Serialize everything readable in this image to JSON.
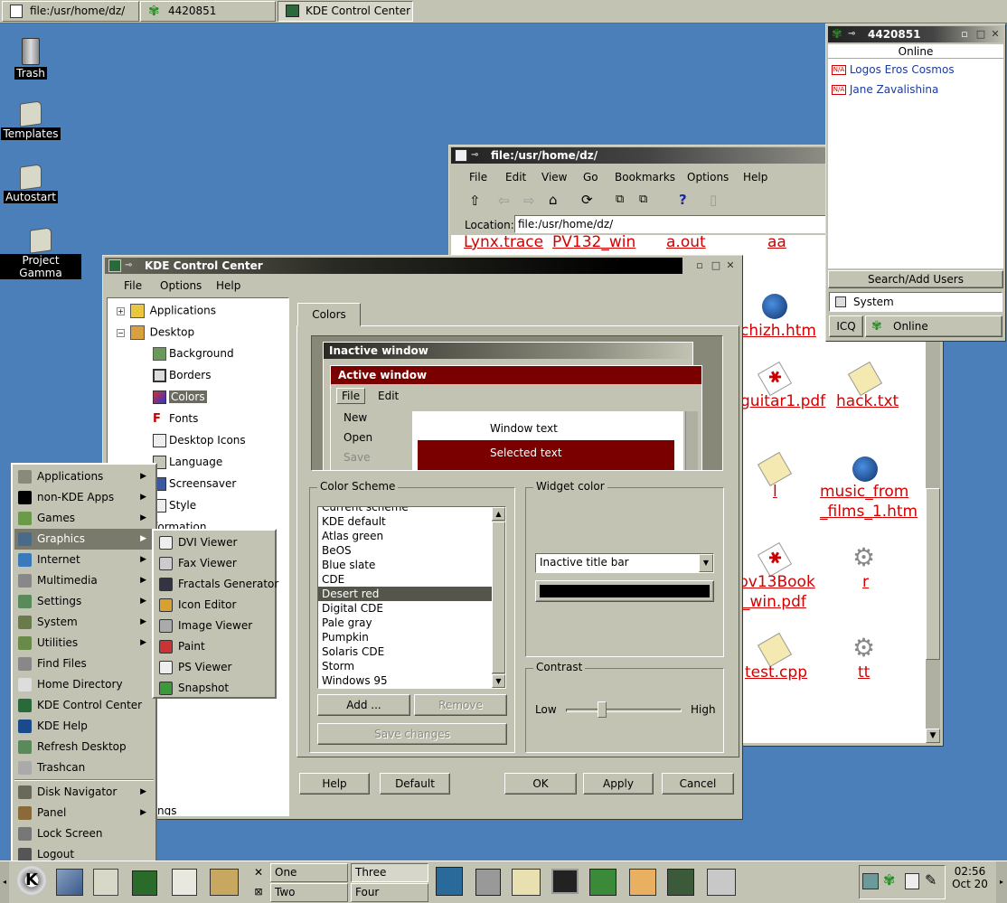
{
  "top_tasks": [
    {
      "label": "file:/usr/home/dz/"
    },
    {
      "label": "4420851"
    },
    {
      "label": "KDE Control Center"
    }
  ],
  "desktop_icons": [
    {
      "label": "Trash"
    },
    {
      "label": "Templates"
    },
    {
      "label": "Autostart"
    },
    {
      "label": "Project Gamma"
    }
  ],
  "icq": {
    "title": "4420851",
    "group": "Online",
    "contacts": [
      "Logos Eros Cosmos",
      "Jane Zavalishina"
    ],
    "search_button": "Search/Add Users",
    "system_label": "System",
    "icq_button": "ICQ",
    "status_button": "Online"
  },
  "konqueror": {
    "title": "file:/usr/home/dz/",
    "menu": [
      "File",
      "Edit",
      "View",
      "Go",
      "Bookmarks",
      "Options",
      "Help"
    ],
    "location_label": "Location:",
    "location_value": "file:/usr/home/dz/",
    "files_top": [
      "Lynx.trace",
      "PV132_win",
      "a.out",
      "aa"
    ],
    "files": [
      {
        "name": "chizh.htm"
      },
      {
        "name": "guitar1.pdf"
      },
      {
        "name": "hack.txt"
      },
      {
        "name": "l"
      },
      {
        "name1": "music_from",
        "name2": "_films_1.htm"
      },
      {
        "name1": "pv13Book",
        "name2": "_win.pdf"
      },
      {
        "name": "r"
      },
      {
        "name": "test.cpp"
      },
      {
        "name": "tt"
      }
    ]
  },
  "kcc": {
    "title": "KDE Control Center",
    "menu": [
      "File",
      "Options",
      "Help"
    ],
    "tree": {
      "applications": "Applications",
      "desktop": "Desktop",
      "children": [
        "Background",
        "Borders",
        "Colors",
        "Fonts",
        "Desktop Icons",
        "Language",
        "Screensaver",
        "Style"
      ],
      "information": "Information",
      "settings_partial": "ngs"
    },
    "tab": "Colors",
    "preview": {
      "inactive_title": "Inactive window",
      "active_title": "Active window",
      "menu_file": "File",
      "menu_edit": "Edit",
      "menu_items": [
        "New",
        "Open",
        "Save"
      ],
      "window_text": "Window text",
      "selected_text": "Selected text"
    },
    "color_scheme": {
      "title": "Color Scheme",
      "items": [
        "Current scheme",
        "KDE default",
        "Atlas green",
        "BeOS",
        "Blue slate",
        "CDE",
        "Desert red",
        "Digital CDE",
        "Pale gray",
        "Pumpkin",
        "Solaris CDE",
        "Storm",
        "Windows 95"
      ],
      "selected": "Desert red",
      "add": "Add ...",
      "remove": "Remove",
      "save": "Save changes"
    },
    "widget_color": {
      "title": "Widget color",
      "selected": "Inactive title bar",
      "swatch": "#000000"
    },
    "contrast": {
      "title": "Contrast",
      "low": "Low",
      "high": "High",
      "value": 0.3
    },
    "buttons": {
      "help": "Help",
      "default": "Default",
      "ok": "OK",
      "apply": "Apply",
      "cancel": "Cancel"
    }
  },
  "kmenu": {
    "items": [
      {
        "label": "Applications",
        "sub": true,
        "icon": "applications-icon"
      },
      {
        "label": "non-KDE Apps",
        "sub": true,
        "icon": "x-icon"
      },
      {
        "label": "Games",
        "sub": true,
        "icon": "games-icon"
      },
      {
        "label": "Graphics",
        "sub": true,
        "icon": "graphics-icon"
      },
      {
        "label": "Internet",
        "sub": true,
        "icon": "internet-icon"
      },
      {
        "label": "Multimedia",
        "sub": true,
        "icon": "multimedia-icon"
      },
      {
        "label": "Settings",
        "sub": true,
        "icon": "settings-icon"
      },
      {
        "label": "System",
        "sub": true,
        "icon": "system-icon"
      },
      {
        "label": "Utilities",
        "sub": true,
        "icon": "utilities-icon"
      },
      {
        "label": "Find Files",
        "sub": false,
        "icon": "find-icon"
      },
      {
        "label": "Home Directory",
        "sub": false,
        "icon": "home-icon"
      },
      {
        "label": "KDE Control Center",
        "sub": false,
        "icon": "kcc-icon"
      },
      {
        "label": "KDE Help",
        "sub": false,
        "icon": "help-icon"
      },
      {
        "label": "Refresh Desktop",
        "sub": false,
        "icon": "refresh-icon"
      },
      {
        "label": "Trashcan",
        "sub": false,
        "icon": "trash-icon"
      },
      {
        "label": "Disk Navigator",
        "sub": true,
        "icon": "disk-icon"
      },
      {
        "label": "Panel",
        "sub": true,
        "icon": "panel-icon"
      },
      {
        "label": "Lock Screen",
        "sub": false,
        "icon": "lock-icon"
      },
      {
        "label": "Logout",
        "sub": false,
        "icon": "logout-icon"
      }
    ],
    "graphics_sub": [
      "DVI Viewer",
      "Fax Viewer",
      "Fractals Generator",
      "Icon Editor",
      "Image Viewer",
      "Paint",
      "PS Viewer",
      "Snapshot"
    ]
  },
  "panel": {
    "desktops": [
      "One",
      "Two",
      "Three",
      "Four"
    ],
    "clock_time": "02:56",
    "clock_date": "Oct 20"
  },
  "colors": {
    "desktop": "#4a7fba",
    "widget": "#c3c3b4",
    "active_title": "#7a0000",
    "link": "#d40000"
  }
}
